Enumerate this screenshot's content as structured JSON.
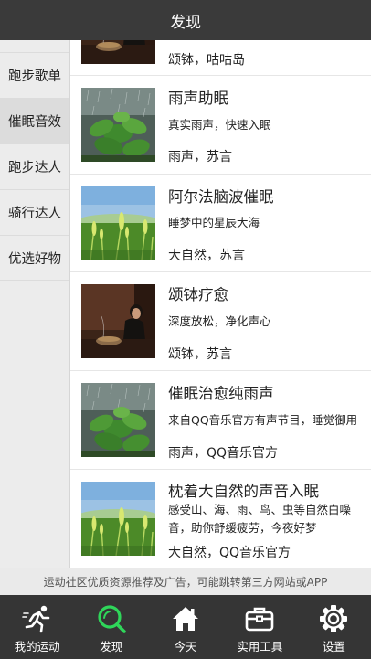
{
  "header": {
    "title": "发现"
  },
  "sidebar": {
    "items": [
      {
        "label": "跑步歌单",
        "active": false
      },
      {
        "label": "催眠音效",
        "active": true
      },
      {
        "label": "跑步达人",
        "active": false
      },
      {
        "label": "骑行达人",
        "active": false
      },
      {
        "label": "优选好物",
        "active": false
      }
    ]
  },
  "cards": [
    {
      "title": "",
      "desc": "",
      "tags": "颂钵，咕咕岛",
      "image": "singing-bowl-woman"
    },
    {
      "title": "雨声助眠",
      "desc": "真实雨声，快速入眠",
      "tags": "雨声，苏言",
      "image": "rain-leaves"
    },
    {
      "title": "阿尔法脑波催眠",
      "desc": "睡梦中的星辰大海",
      "tags": "大自然，苏言",
      "image": "wheat-field"
    },
    {
      "title": "颂钵疗愈",
      "desc": "深度放松，净化声心",
      "tags": "颂钵，苏言",
      "image": "singing-bowl-woman"
    },
    {
      "title": "催眠治愈纯雨声",
      "desc": "来自QQ音乐官方有声节目，睡觉御用",
      "tags": "雨声，QQ音乐官方",
      "image": "rain-leaves"
    },
    {
      "title": "枕着大自然的声音入眠",
      "desc": "感受山、海、雨、鸟、虫等自然白噪音，助你舒缓疲劳，今夜好梦",
      "tags": "大自然，QQ音乐官方",
      "image": "wheat-field"
    }
  ],
  "disclaimer": "运动社区优质资源推荐及广告，可能跳转第三方网站或APP",
  "tabbar": {
    "items": [
      {
        "label": "我的运动",
        "icon": "runner-icon",
        "active": false
      },
      {
        "label": "发现",
        "icon": "search-icon",
        "active": true
      },
      {
        "label": "今天",
        "icon": "home-icon",
        "active": false
      },
      {
        "label": "实用工具",
        "icon": "toolbox-icon",
        "active": false
      },
      {
        "label": "设置",
        "icon": "gear-icon",
        "active": false
      }
    ]
  },
  "colors": {
    "header_bg": "#3a3a3a",
    "tabbar_bg": "#353535",
    "accent": "#2fd65a",
    "sidebar_bg": "#ececec"
  }
}
